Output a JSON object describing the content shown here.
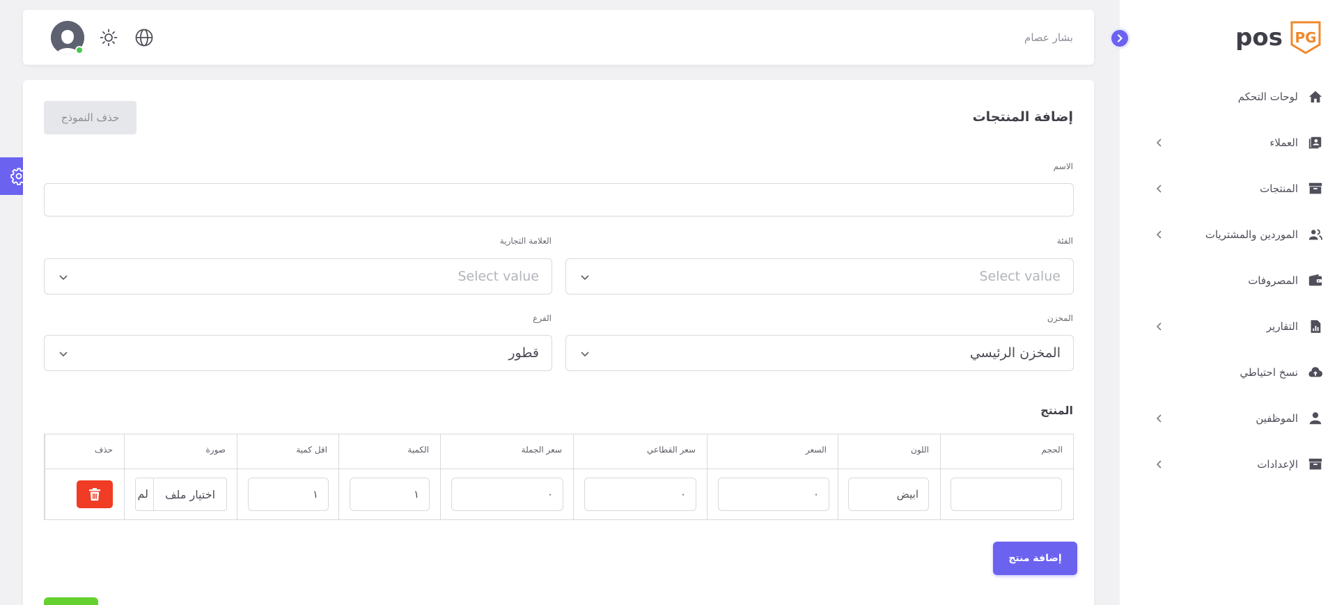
{
  "brand": {
    "name": "pos",
    "badge": "PG"
  },
  "header": {
    "user_name": "بشار عصام"
  },
  "sidebar": {
    "items": [
      {
        "label": "لوحات التحكم",
        "icon": "home-icon",
        "chevron": false
      },
      {
        "label": "العملاء",
        "icon": "contacts-icon",
        "chevron": true
      },
      {
        "label": "المنتجات",
        "icon": "archive-icon",
        "chevron": true
      },
      {
        "label": "الموردين والمشتريات",
        "icon": "users-icon",
        "chevron": true
      },
      {
        "label": "المصروفات",
        "icon": "wallet-icon",
        "chevron": false
      },
      {
        "label": "التقارير",
        "icon": "report-icon",
        "chevron": true
      },
      {
        "label": "نسخ احتياطي",
        "icon": "cloud-upload-icon",
        "chevron": false
      },
      {
        "label": "الموظفين",
        "icon": "user-icon",
        "chevron": true
      },
      {
        "label": "الإعدادات",
        "icon": "archive-icon",
        "chevron": true
      }
    ]
  },
  "form": {
    "title": "إضافة المنتجات",
    "delete_form_label": "حذف النموذج",
    "name_label": "الاسم",
    "name_value": "",
    "category_label": "الفئة",
    "category_placeholder": "Select value",
    "brand_label": "العلامة التجارية",
    "brand_placeholder": "Select value",
    "warehouse_label": "المخزن",
    "warehouse_value": "المخزن الرئيسي",
    "branch_label": "الفرع",
    "branch_value": "قطور",
    "product_section_title": "المنتج",
    "add_product_label": "إضافة منتج"
  },
  "table": {
    "headers": [
      "الحجم",
      "اللون",
      "السعر",
      "سعر القطاعي",
      "سعر الجملة",
      "الكمية",
      "اقل كمية",
      "صورة",
      "حذف"
    ],
    "row": {
      "size": "",
      "color": "ابيض",
      "price": "٠",
      "retail_price": "٠",
      "wholesale_price": "٠",
      "quantity": "١",
      "min_quantity": "١",
      "file_button": "اختيار ملف",
      "file_status": "لم"
    }
  },
  "colors": {
    "accent": "#6b62f0",
    "danger": "#f03c25",
    "success": "#64d12f",
    "brand_orange": "#f0892b"
  }
}
